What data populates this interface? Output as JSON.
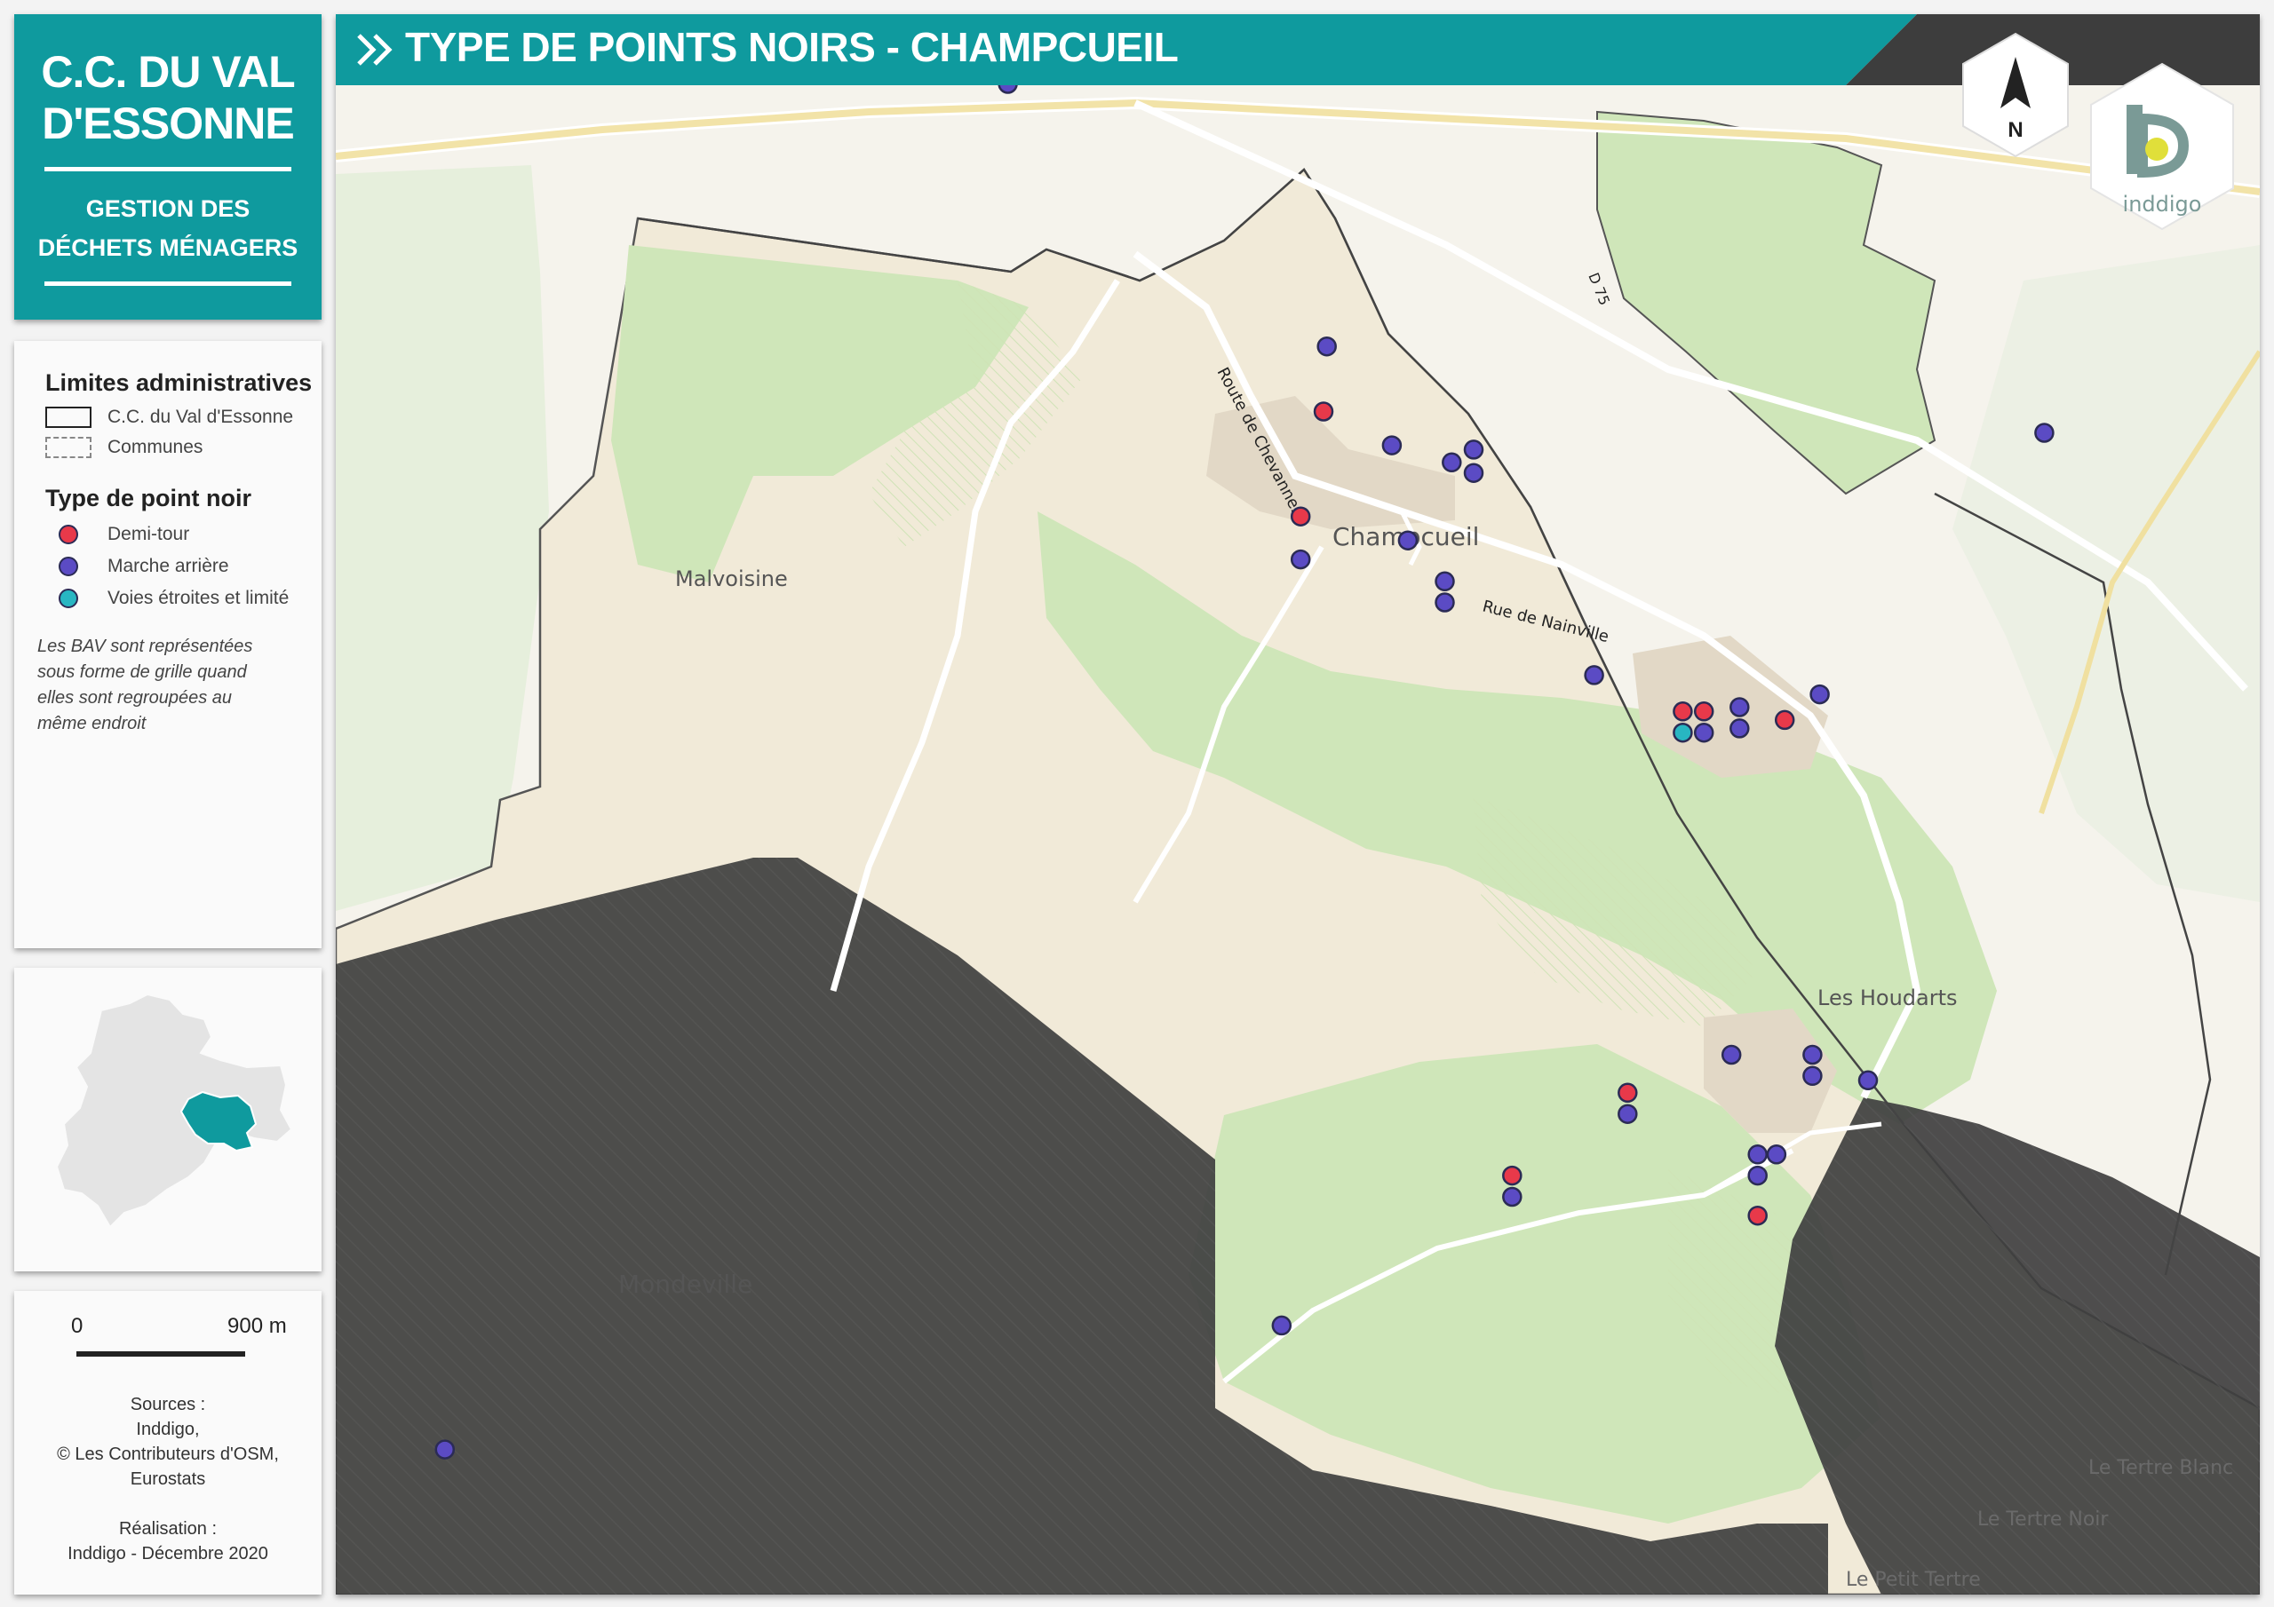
{
  "title_box": {
    "org_line1": "C.C. DU VAL",
    "org_line2": "D'ESSONNE",
    "sub_line1": "GESTION DES",
    "sub_line2": "DÉCHETS MÉNAGERS"
  },
  "map": {
    "title": "TYPE DE POINTS NOIRS - CHAMPCUEIL",
    "north": "N",
    "logo_text": "inddigo"
  },
  "legend": {
    "admin_heading": "Limites administratives",
    "admin_items": [
      {
        "label": "C.C. du Val d'Essonne",
        "style": "solid"
      },
      {
        "label": "Communes",
        "style": "dashed"
      }
    ],
    "type_heading": "Type de point noir",
    "type_items": [
      {
        "label": "Demi-tour",
        "color": "#e8394a"
      },
      {
        "label": "Marche arrière",
        "color": "#5b4bc4"
      },
      {
        "label": "Voies étroites et limité",
        "color": "#28b6c2"
      }
    ],
    "note": "Les BAV sont représentées sous forme de grille quand elles sont regroupées au même endroit"
  },
  "scale": {
    "start": "0",
    "end": "900 m",
    "sources_line1": "Sources :",
    "sources_line2": "Inddigo,",
    "sources_line3": "© Les Contributeurs d'OSM,",
    "sources_line4": "Eurostats",
    "realisation_line1": "Réalisation :",
    "realisation_line2": "Inddigo - Décembre 2020"
  },
  "places": {
    "champcueil": "Champcueil",
    "malvoisine": "Malvoisine",
    "les_houdarts": "Les Houdarts",
    "mondeville": "Mondeville",
    "tertre_blanc": "Le Tertre Blanc",
    "tertre_noir": "Le Tertre Noir",
    "petit_tertre": "Le Petit Tertre"
  },
  "roads": {
    "route_chevannes": "Route de Chevannes",
    "rue_nainville": "Rue de Nainville",
    "d75": "D 75"
  },
  "colors": {
    "teal": "#0f9a9e",
    "dark_band": "#3d3d3d",
    "demi_tour": "#e8394a",
    "marche_arriere": "#5b4bc4",
    "voies_etroites": "#28b6c2"
  },
  "points": [
    {
      "type": "marche_arriere",
      "x_pct": 0.3493,
      "y_pct": 0.0441
    },
    {
      "type": "marche_arriere",
      "x_pct": 0.888,
      "y_pct": 0.2649
    },
    {
      "type": "marche_arriere",
      "x_pct": 0.5151,
      "y_pct": 0.2102
    },
    {
      "type": "demi_tour",
      "x_pct": 0.5134,
      "y_pct": 0.2514
    },
    {
      "type": "marche_arriere",
      "x_pct": 0.5489,
      "y_pct": 0.2728
    },
    {
      "type": "marche_arriere",
      "x_pct": 0.58,
      "y_pct": 0.2836
    },
    {
      "type": "marche_arriere",
      "x_pct": 0.5914,
      "y_pct": 0.2755
    },
    {
      "type": "marche_arriere",
      "x_pct": 0.5914,
      "y_pct": 0.2903
    },
    {
      "type": "demi_tour",
      "x_pct": 0.5015,
      "y_pct": 0.3178
    },
    {
      "type": "marche_arriere",
      "x_pct": 0.5015,
      "y_pct": 0.345
    },
    {
      "type": "marche_arriere",
      "x_pct": 0.5572,
      "y_pct": 0.333
    },
    {
      "type": "marche_arriere",
      "x_pct": 0.5764,
      "y_pct": 0.3589
    },
    {
      "type": "marche_arriere",
      "x_pct": 0.5764,
      "y_pct": 0.3722
    },
    {
      "type": "marche_arriere",
      "x_pct": 0.654,
      "y_pct": 0.4182
    },
    {
      "type": "demi_tour",
      "x_pct": 0.7001,
      "y_pct": 0.4412
    },
    {
      "type": "demi_tour",
      "x_pct": 0.7111,
      "y_pct": 0.4412
    },
    {
      "type": "voies_etroites",
      "x_pct": 0.7001,
      "y_pct": 0.4546
    },
    {
      "type": "marche_arriere",
      "x_pct": 0.7111,
      "y_pct": 0.4546
    },
    {
      "type": "marche_arriere",
      "x_pct": 0.7296,
      "y_pct": 0.4385
    },
    {
      "type": "marche_arriere",
      "x_pct": 0.7296,
      "y_pct": 0.4519
    },
    {
      "type": "demi_tour",
      "x_pct": 0.7531,
      "y_pct": 0.4466
    },
    {
      "type": "marche_arriere",
      "x_pct": 0.7713,
      "y_pct": 0.4304
    },
    {
      "type": "marche_arriere",
      "x_pct": 0.7254,
      "y_pct": 0.6584
    },
    {
      "type": "marche_arriere",
      "x_pct": 0.7675,
      "y_pct": 0.6584
    },
    {
      "type": "marche_arriere",
      "x_pct": 0.7675,
      "y_pct": 0.6718
    },
    {
      "type": "marche_arriere",
      "x_pct": 0.7964,
      "y_pct": 0.6746
    },
    {
      "type": "demi_tour",
      "x_pct": 0.6714,
      "y_pct": 0.6825
    },
    {
      "type": "marche_arriere",
      "x_pct": 0.6714,
      "y_pct": 0.6959
    },
    {
      "type": "marche_arriere",
      "x_pct": 0.739,
      "y_pct": 0.7215
    },
    {
      "type": "marche_arriere",
      "x_pct": 0.7488,
      "y_pct": 0.7215
    },
    {
      "type": "marche_arriere",
      "x_pct": 0.739,
      "y_pct": 0.7349
    },
    {
      "type": "demi_tour",
      "x_pct": 0.739,
      "y_pct": 0.7602
    },
    {
      "type": "demi_tour",
      "x_pct": 0.6114,
      "y_pct": 0.7349
    },
    {
      "type": "marche_arriere",
      "x_pct": 0.6114,
      "y_pct": 0.7483
    },
    {
      "type": "marche_arriere",
      "x_pct": 0.4916,
      "y_pct": 0.8297
    },
    {
      "type": "marche_arriere",
      "x_pct": 0.0567,
      "y_pct": 0.9082
    }
  ]
}
